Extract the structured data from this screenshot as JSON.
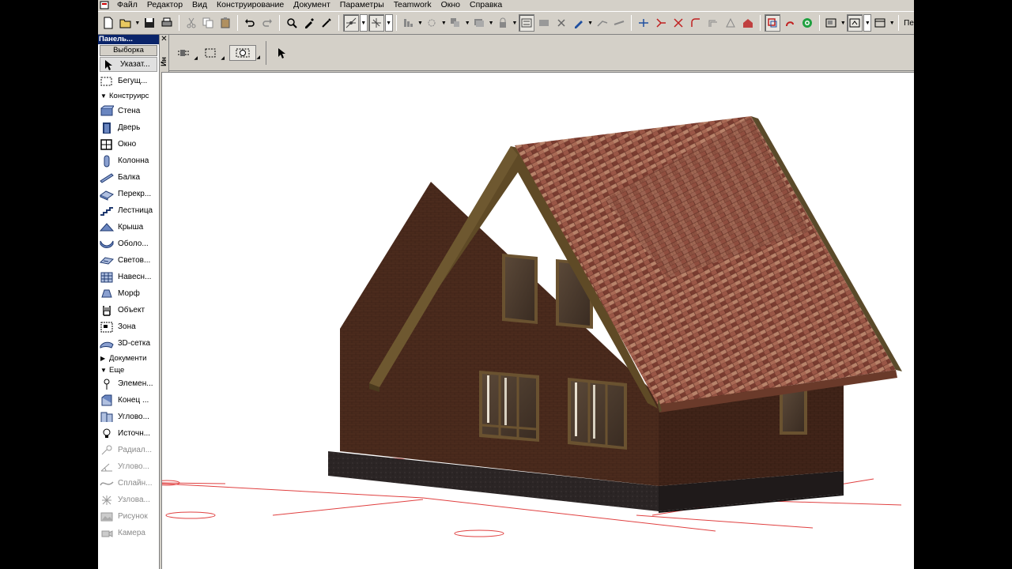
{
  "menu": {
    "items": [
      "Файл",
      "Редактор",
      "Вид",
      "Конструирование",
      "Документ",
      "Параметры",
      "Teamwork",
      "Окно",
      "Справка"
    ]
  },
  "toolbar": {
    "overflow_label": "Пе"
  },
  "toolbox": {
    "title": "Панель...",
    "select_label": "Выборка",
    "pointer_label": "Указат...",
    "marquee_label": "Бегущ...",
    "design_section": "Конструирс",
    "design_tools": [
      {
        "label": "Стена",
        "icon": "wall-icon"
      },
      {
        "label": "Дверь",
        "icon": "door-icon"
      },
      {
        "label": "Окно",
        "icon": "window-icon"
      },
      {
        "label": "Колонна",
        "icon": "column-icon"
      },
      {
        "label": "Балка",
        "icon": "beam-icon"
      },
      {
        "label": "Перекр...",
        "icon": "slab-icon"
      },
      {
        "label": "Лестница",
        "icon": "stair-icon"
      },
      {
        "label": "Крыша",
        "icon": "roof-icon"
      },
      {
        "label": "Оболо...",
        "icon": "shell-icon"
      },
      {
        "label": "Светов...",
        "icon": "skylight-icon"
      },
      {
        "label": "Навесн...",
        "icon": "curtain-wall-icon"
      },
      {
        "label": "Морф",
        "icon": "morph-icon"
      },
      {
        "label": "Объект",
        "icon": "object-icon"
      },
      {
        "label": "Зона",
        "icon": "zone-icon"
      },
      {
        "label": "3D-сетка",
        "icon": "mesh-icon"
      }
    ],
    "document_section": "Документи",
    "more_section": "Еще",
    "more_tools": [
      {
        "label": "Элемен...",
        "icon": "element-icon",
        "disabled": false
      },
      {
        "label": "Конец ...",
        "icon": "wall-end-icon",
        "disabled": false
      },
      {
        "label": "Углово...",
        "icon": "corner-window-icon",
        "disabled": false
      },
      {
        "label": "Источн...",
        "icon": "lamp-icon",
        "disabled": false
      },
      {
        "label": "Радиал...",
        "icon": "radial-dimension-icon",
        "disabled": true
      },
      {
        "label": "Углово...",
        "icon": "angle-dimension-icon",
        "disabled": true
      },
      {
        "label": "Сплайн...",
        "icon": "spline-icon",
        "disabled": true
      },
      {
        "label": "Узлова...",
        "icon": "hotspot-icon",
        "disabled": true
      },
      {
        "label": "Рисунок",
        "icon": "figure-icon",
        "disabled": true
      },
      {
        "label": "Камера",
        "icon": "camera-icon",
        "disabled": true
      }
    ]
  },
  "infobox": {
    "strip_label": "Ин"
  },
  "colors": {
    "chrome": "#d4d0c8",
    "title_bar": "#0a246a",
    "roof": "#8a4a3a",
    "brick": "#4a2a1c",
    "trim": "#6a5230",
    "foundation": "#2a2424",
    "grid_line": "#e03030"
  }
}
